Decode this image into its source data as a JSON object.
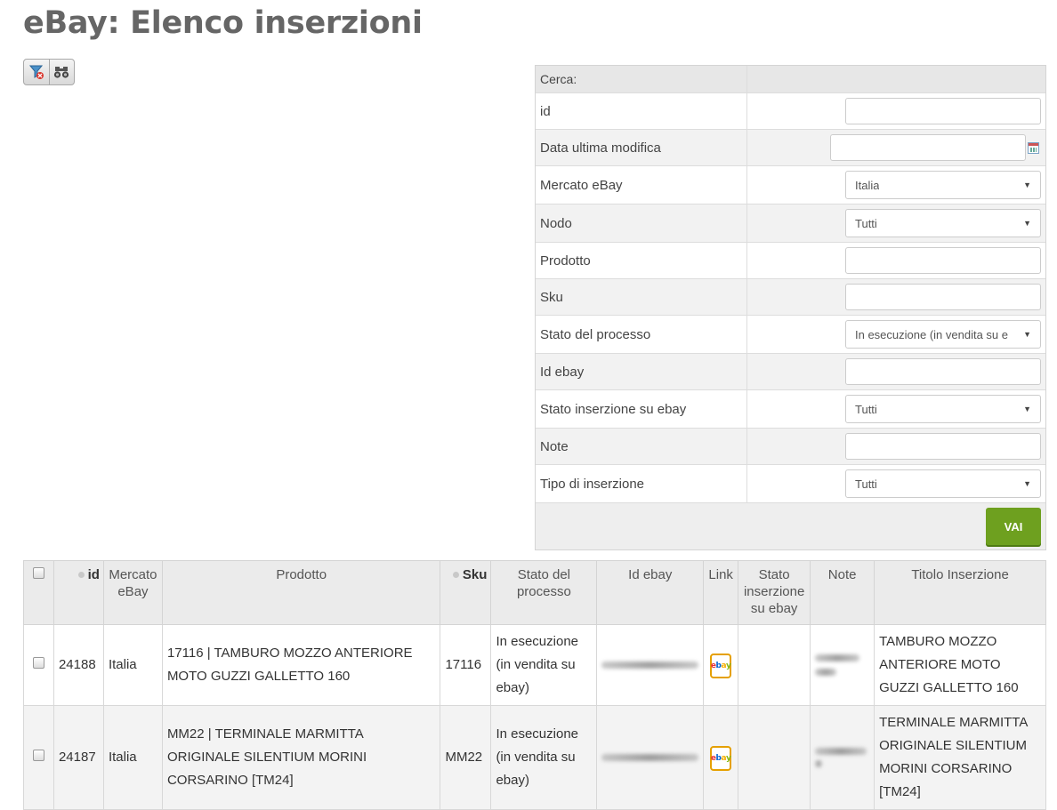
{
  "page": {
    "title": "eBay: Elenco inserzioni"
  },
  "toolbar": {
    "filter_icon": "filter-remove-icon",
    "binoculars_icon": "binoculars-icon"
  },
  "search": {
    "header": "Cerca:",
    "fields": {
      "id": {
        "label": "id",
        "value": ""
      },
      "data": {
        "label": "Data ultima modifica",
        "value": ""
      },
      "mercato": {
        "label": "Mercato eBay",
        "value": "Italia"
      },
      "nodo": {
        "label": "Nodo",
        "value": "Tutti"
      },
      "prodotto": {
        "label": "Prodotto",
        "value": ""
      },
      "sku": {
        "label": "Sku",
        "value": ""
      },
      "stato_processo": {
        "label": "Stato del processo",
        "value": "In esecuzione (in vendita su e"
      },
      "id_ebay": {
        "label": "Id ebay",
        "value": ""
      },
      "stato_inserzione": {
        "label": "Stato inserzione su ebay",
        "value": "Tutti"
      },
      "note": {
        "label": "Note",
        "value": ""
      },
      "tipo": {
        "label": "Tipo di inserzione",
        "value": "Tutti"
      }
    },
    "submit_label": "VAI"
  },
  "table": {
    "columns": {
      "id": "id",
      "mercato": "Mercato eBay",
      "prodotto": "Prodotto",
      "sku": "Sku",
      "stato_processo": "Stato del processo",
      "id_ebay": "Id ebay",
      "link": "Link",
      "stato_inserzione": "Stato inserzione su ebay",
      "note": "Note",
      "titolo": "Titolo Inserzione"
    },
    "rows": [
      {
        "id": "24188",
        "mercato": "Italia",
        "prodotto": "17116 | TAMBURO MOZZO ANTERIORE MOTO GUZZI GALLETTO 160",
        "sku": "17116",
        "stato_processo": "In esecuzione (in vendita su ebay)",
        "titolo": "TAMBURO MOZZO ANTERIORE MOTO GUZZI GALLETTO 160"
      },
      {
        "id": "24187",
        "mercato": "Italia",
        "prodotto": "MM22 | TERMINALE MARMITTA ORIGINALE SILENTIUM MORINI CORSARINO [TM24]",
        "sku": "MM22",
        "stato_processo": "In esecuzione (in vendita su ebay)",
        "titolo": "TERMINALE MARMITTA ORIGINALE SILENTIUM MORINI CORSARINO [TM24]"
      }
    ]
  }
}
